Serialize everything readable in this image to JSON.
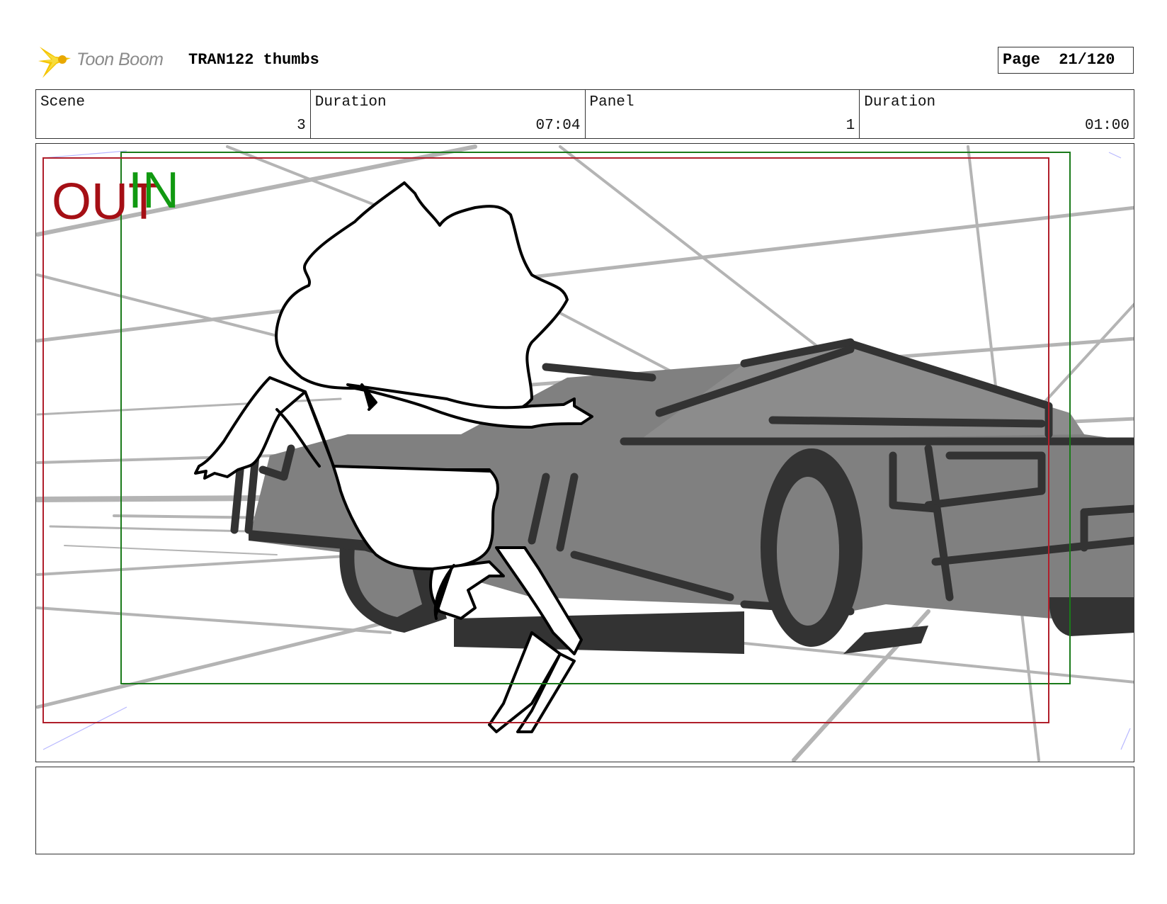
{
  "header": {
    "logo_text": "Toon Boom",
    "project_title": "TRAN122 thumbs",
    "page_label": "Page",
    "page_value": "21/120"
  },
  "info": {
    "scene_label": "Scene",
    "scene_value": "3",
    "scene_duration_label": "Duration",
    "scene_duration_value": "07:04",
    "panel_label": "Panel",
    "panel_value": "1",
    "panel_duration_label": "Duration",
    "panel_duration_value": "01:00"
  },
  "panel": {
    "out_label": "OUT",
    "in_label": "IN",
    "out_color": "#a50f15",
    "in_color": "#119911"
  },
  "notes": {
    "text": ""
  }
}
